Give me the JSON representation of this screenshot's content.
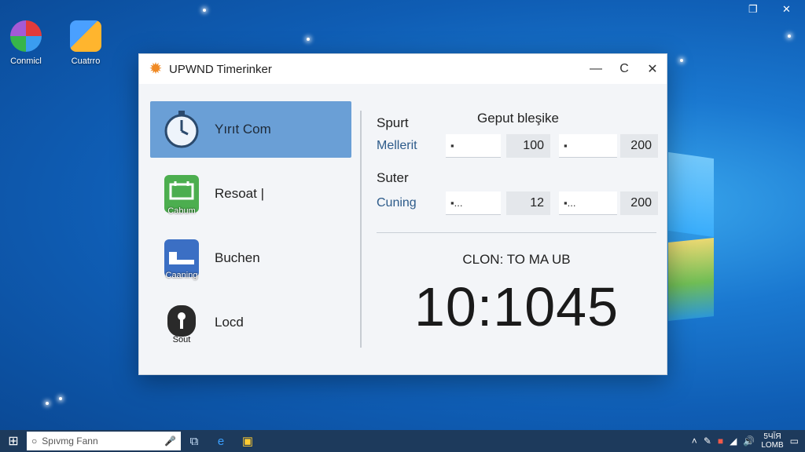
{
  "desktop": {
    "icons": [
      {
        "label": "Conmicl",
        "icon": "browser-icon"
      },
      {
        "label": "Cuatrro",
        "icon": "calculator-icon"
      }
    ],
    "top_controls": {
      "restore": "❐",
      "close": "✕"
    }
  },
  "window": {
    "title": "UPWND Timerinker",
    "controls": {
      "minimize": "—",
      "maximize": "C",
      "close": "✕"
    }
  },
  "sidebar": {
    "items": [
      {
        "label": "Yırıt Com",
        "icon": "stopwatch-icon",
        "caption": "",
        "active": true
      },
      {
        "label": "Resoat |",
        "icon": "calendar-icon",
        "caption": "Cabum"
      },
      {
        "label": "Buchen",
        "icon": "bed-icon",
        "caption": "Caaning"
      },
      {
        "label": "Locd",
        "icon": "lock-icon",
        "caption": "Sout"
      }
    ]
  },
  "settings": {
    "section1_title": "Spurt",
    "column_header": "Geput bleşike",
    "row1": {
      "label": "Mellerit",
      "field1": "▪",
      "value1": "100",
      "field2": "▪",
      "value2": "200"
    },
    "section2_title": "Suter",
    "row2": {
      "label": "Cuning",
      "field1": "▪...",
      "value1": "12",
      "field2": "▪...",
      "value2": "200"
    }
  },
  "clock": {
    "label": "CLON: TO MA UB",
    "time": "10:1045"
  },
  "taskbar": {
    "search_placeholder": "Spıvmg Fann",
    "tray_time": "5ЧĬЯ",
    "tray_date": "LOMB"
  }
}
